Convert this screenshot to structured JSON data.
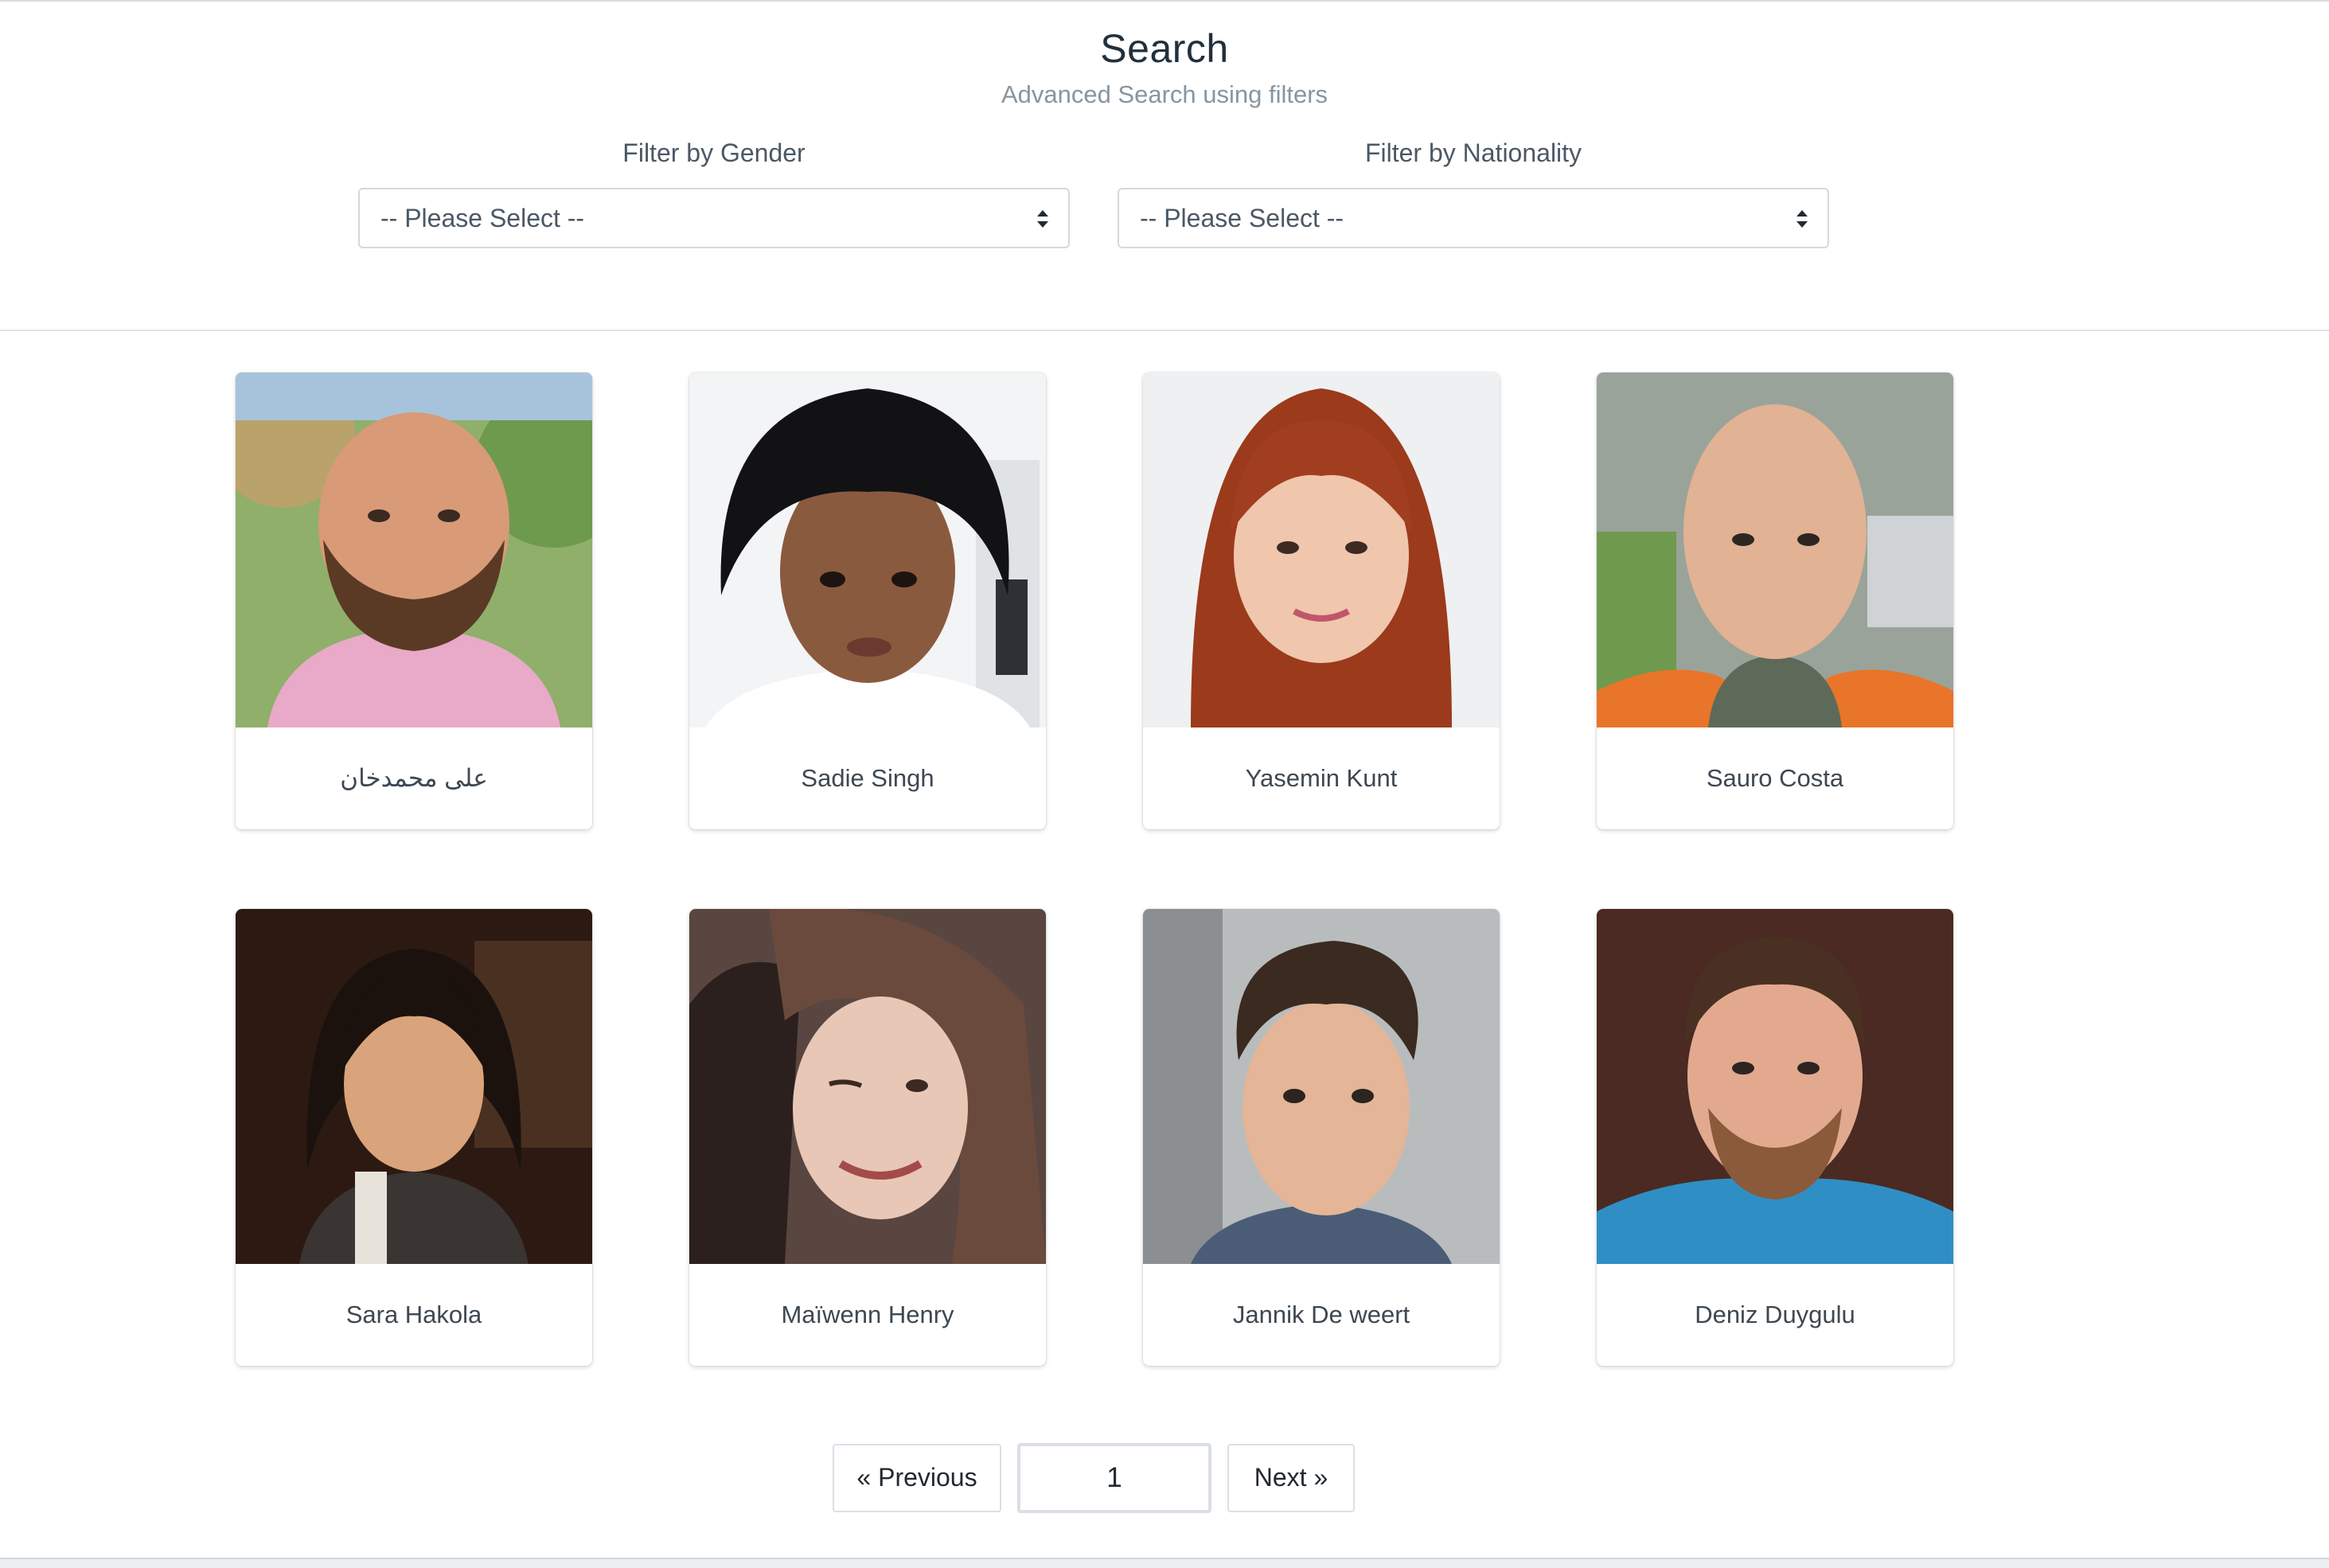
{
  "header": {
    "title": "Search",
    "subtitle": "Advanced Search using filters"
  },
  "filters": {
    "gender": {
      "label": "Filter by Gender",
      "value": "-- Please Select --"
    },
    "nationality": {
      "label": "Filter by Nationality",
      "value": "-- Please Select --"
    }
  },
  "people": [
    {
      "name": "على محمدخان",
      "photo": "bearded-man-pink-shirt-photo"
    },
    {
      "name": "Sadie Singh",
      "photo": "woman-black-bob-photo"
    },
    {
      "name": "Yasemin Kunt",
      "photo": "woman-red-hair-photo"
    },
    {
      "name": "Sauro Costa",
      "photo": "bald-man-orange-jacket-photo"
    },
    {
      "name": "Sara Hakola",
      "photo": "woman-dark-hair-photo"
    },
    {
      "name": "Maïwenn Henry",
      "photo": "woman-winking-photo"
    },
    {
      "name": "Jannik De weert",
      "photo": "young-man-quiff-photo"
    },
    {
      "name": "Deniz Duygulu",
      "photo": "bearded-man-blue-shirt-photo"
    }
  ],
  "pagination": {
    "previous_label": "« Previous",
    "current_page": "1",
    "next_label": "Next »"
  },
  "colors": {
    "title": "#22303d",
    "subtitle": "#8795a1",
    "border": "#d4d9df"
  }
}
